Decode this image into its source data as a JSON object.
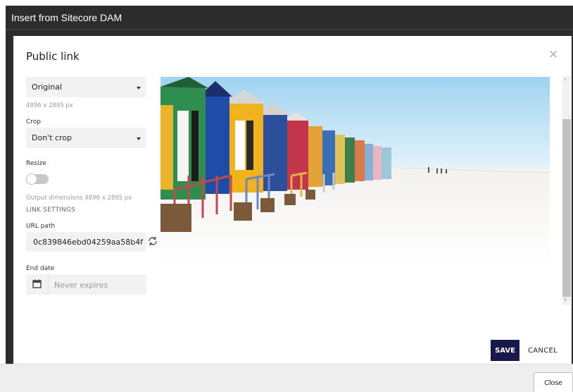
{
  "window": {
    "title": "Insert from Sitecore DAM"
  },
  "dialog": {
    "title": "Public link",
    "close_icon": "close-icon",
    "format": {
      "selected": "Original",
      "dimensions": "4896 x 2895 px"
    },
    "crop": {
      "label": "Crop",
      "selected": "Don't crop"
    },
    "resize": {
      "label": "Resize",
      "enabled": false
    },
    "output_dimensions": "Output dimensions 4896 x 2895 px",
    "link_settings": {
      "heading": "LINK SETTINGS",
      "url_path_label": "URL path",
      "url_path_value": "0c839846ebd04259aa58b4f",
      "refresh_icon": "refresh-icon",
      "end_date_label": "End date",
      "end_date_placeholder": "Never expires",
      "calendar_icon": "calendar-icon"
    },
    "preview": {
      "subject": "beach-huts-photo"
    },
    "buttons": {
      "save": "SAVE",
      "cancel": "CANCEL"
    }
  },
  "footer": {
    "close_label": "Close"
  },
  "colors": {
    "titlebar": "#2c2c2c",
    "save_button": "#17194a",
    "field_bg": "#f2f2f2"
  }
}
